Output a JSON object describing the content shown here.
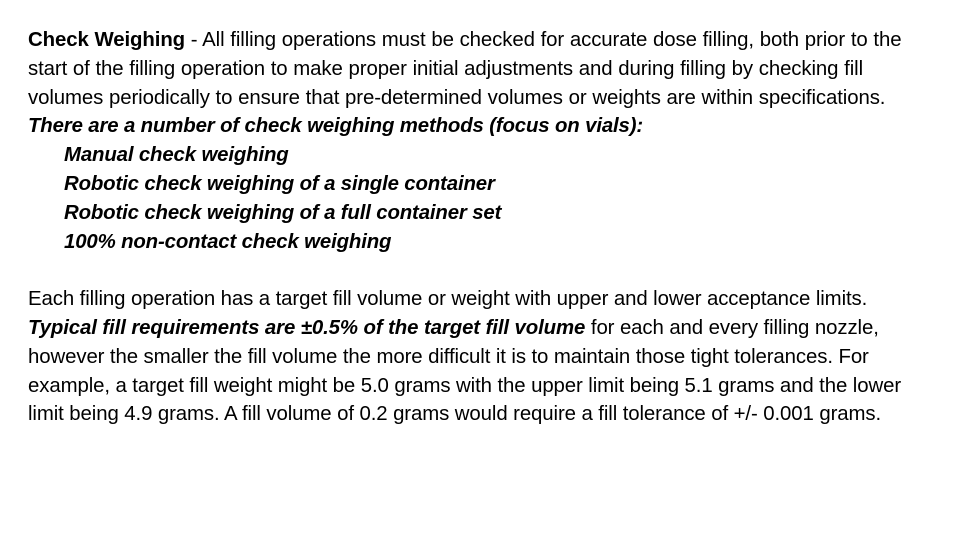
{
  "slide": {
    "background_color": "#FFFFFF",
    "text_color": "#000000",
    "paragraph_1": {
      "lead_in": "Check Weighing",
      "body": " - All filling operations must be checked for accurate dose filling, both prior to the start of the filling operation to make proper initial adjustments and during filling by checking fill volumes periodically to ensure that pre-determined volumes or weights are within specifications."
    },
    "methods_intro": "There are a number of check weighing methods (focus on vials):",
    "methods": [
      "Manual check weighing",
      "Robotic check weighing of a single container",
      "Robotic check weighing of a full container set",
      "100% non-contact check weighing"
    ],
    "paragraph_2": {
      "part_1": "Each filling operation has a target fill volume or weight with upper and lower acceptance limits.  ",
      "emphasis": "Typical fill requirements are ±0.5% of the target fill volume",
      "part_2": " for each and every filling nozzle, however the smaller the fill volume the more difficult it is to maintain those tight tolerances.  For example, a target fill weight might be 5.0 grams with the upper limit being 5.1 grams and the lower limit being 4.9 grams.  A fill volume of 0.2 grams would require a fill tolerance of +/- 0.001 grams."
    }
  }
}
